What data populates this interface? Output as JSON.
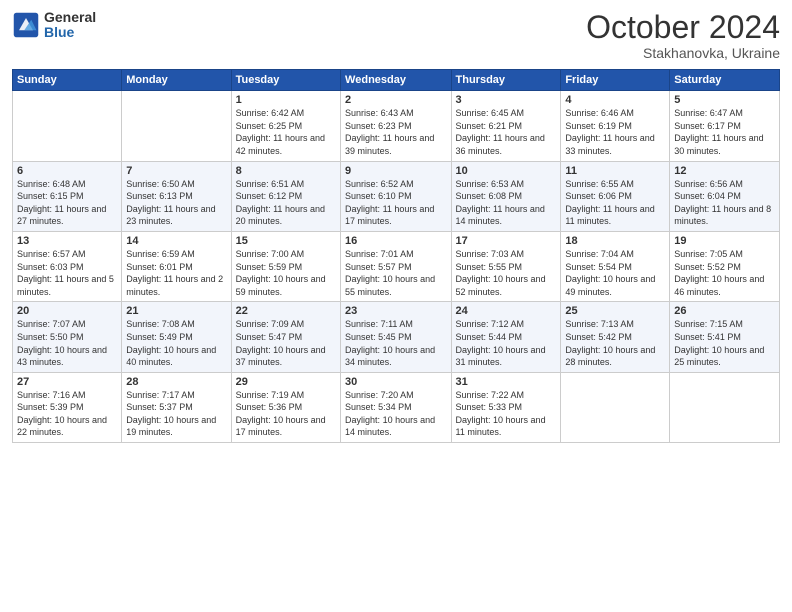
{
  "header": {
    "logo_general": "General",
    "logo_blue": "Blue",
    "month": "October 2024",
    "location": "Stakhanovka, Ukraine"
  },
  "weekdays": [
    "Sunday",
    "Monday",
    "Tuesday",
    "Wednesday",
    "Thursday",
    "Friday",
    "Saturday"
  ],
  "weeks": [
    [
      {
        "day": "",
        "sunrise": "",
        "sunset": "",
        "daylight": ""
      },
      {
        "day": "",
        "sunrise": "",
        "sunset": "",
        "daylight": ""
      },
      {
        "day": "1",
        "sunrise": "Sunrise: 6:42 AM",
        "sunset": "Sunset: 6:25 PM",
        "daylight": "Daylight: 11 hours and 42 minutes."
      },
      {
        "day": "2",
        "sunrise": "Sunrise: 6:43 AM",
        "sunset": "Sunset: 6:23 PM",
        "daylight": "Daylight: 11 hours and 39 minutes."
      },
      {
        "day": "3",
        "sunrise": "Sunrise: 6:45 AM",
        "sunset": "Sunset: 6:21 PM",
        "daylight": "Daylight: 11 hours and 36 minutes."
      },
      {
        "day": "4",
        "sunrise": "Sunrise: 6:46 AM",
        "sunset": "Sunset: 6:19 PM",
        "daylight": "Daylight: 11 hours and 33 minutes."
      },
      {
        "day": "5",
        "sunrise": "Sunrise: 6:47 AM",
        "sunset": "Sunset: 6:17 PM",
        "daylight": "Daylight: 11 hours and 30 minutes."
      }
    ],
    [
      {
        "day": "6",
        "sunrise": "Sunrise: 6:48 AM",
        "sunset": "Sunset: 6:15 PM",
        "daylight": "Daylight: 11 hours and 27 minutes."
      },
      {
        "day": "7",
        "sunrise": "Sunrise: 6:50 AM",
        "sunset": "Sunset: 6:13 PM",
        "daylight": "Daylight: 11 hours and 23 minutes."
      },
      {
        "day": "8",
        "sunrise": "Sunrise: 6:51 AM",
        "sunset": "Sunset: 6:12 PM",
        "daylight": "Daylight: 11 hours and 20 minutes."
      },
      {
        "day": "9",
        "sunrise": "Sunrise: 6:52 AM",
        "sunset": "Sunset: 6:10 PM",
        "daylight": "Daylight: 11 hours and 17 minutes."
      },
      {
        "day": "10",
        "sunrise": "Sunrise: 6:53 AM",
        "sunset": "Sunset: 6:08 PM",
        "daylight": "Daylight: 11 hours and 14 minutes."
      },
      {
        "day": "11",
        "sunrise": "Sunrise: 6:55 AM",
        "sunset": "Sunset: 6:06 PM",
        "daylight": "Daylight: 11 hours and 11 minutes."
      },
      {
        "day": "12",
        "sunrise": "Sunrise: 6:56 AM",
        "sunset": "Sunset: 6:04 PM",
        "daylight": "Daylight: 11 hours and 8 minutes."
      }
    ],
    [
      {
        "day": "13",
        "sunrise": "Sunrise: 6:57 AM",
        "sunset": "Sunset: 6:03 PM",
        "daylight": "Daylight: 11 hours and 5 minutes."
      },
      {
        "day": "14",
        "sunrise": "Sunrise: 6:59 AM",
        "sunset": "Sunset: 6:01 PM",
        "daylight": "Daylight: 11 hours and 2 minutes."
      },
      {
        "day": "15",
        "sunrise": "Sunrise: 7:00 AM",
        "sunset": "Sunset: 5:59 PM",
        "daylight": "Daylight: 10 hours and 59 minutes."
      },
      {
        "day": "16",
        "sunrise": "Sunrise: 7:01 AM",
        "sunset": "Sunset: 5:57 PM",
        "daylight": "Daylight: 10 hours and 55 minutes."
      },
      {
        "day": "17",
        "sunrise": "Sunrise: 7:03 AM",
        "sunset": "Sunset: 5:55 PM",
        "daylight": "Daylight: 10 hours and 52 minutes."
      },
      {
        "day": "18",
        "sunrise": "Sunrise: 7:04 AM",
        "sunset": "Sunset: 5:54 PM",
        "daylight": "Daylight: 10 hours and 49 minutes."
      },
      {
        "day": "19",
        "sunrise": "Sunrise: 7:05 AM",
        "sunset": "Sunset: 5:52 PM",
        "daylight": "Daylight: 10 hours and 46 minutes."
      }
    ],
    [
      {
        "day": "20",
        "sunrise": "Sunrise: 7:07 AM",
        "sunset": "Sunset: 5:50 PM",
        "daylight": "Daylight: 10 hours and 43 minutes."
      },
      {
        "day": "21",
        "sunrise": "Sunrise: 7:08 AM",
        "sunset": "Sunset: 5:49 PM",
        "daylight": "Daylight: 10 hours and 40 minutes."
      },
      {
        "day": "22",
        "sunrise": "Sunrise: 7:09 AM",
        "sunset": "Sunset: 5:47 PM",
        "daylight": "Daylight: 10 hours and 37 minutes."
      },
      {
        "day": "23",
        "sunrise": "Sunrise: 7:11 AM",
        "sunset": "Sunset: 5:45 PM",
        "daylight": "Daylight: 10 hours and 34 minutes."
      },
      {
        "day": "24",
        "sunrise": "Sunrise: 7:12 AM",
        "sunset": "Sunset: 5:44 PM",
        "daylight": "Daylight: 10 hours and 31 minutes."
      },
      {
        "day": "25",
        "sunrise": "Sunrise: 7:13 AM",
        "sunset": "Sunset: 5:42 PM",
        "daylight": "Daylight: 10 hours and 28 minutes."
      },
      {
        "day": "26",
        "sunrise": "Sunrise: 7:15 AM",
        "sunset": "Sunset: 5:41 PM",
        "daylight": "Daylight: 10 hours and 25 minutes."
      }
    ],
    [
      {
        "day": "27",
        "sunrise": "Sunrise: 7:16 AM",
        "sunset": "Sunset: 5:39 PM",
        "daylight": "Daylight: 10 hours and 22 minutes."
      },
      {
        "day": "28",
        "sunrise": "Sunrise: 7:17 AM",
        "sunset": "Sunset: 5:37 PM",
        "daylight": "Daylight: 10 hours and 19 minutes."
      },
      {
        "day": "29",
        "sunrise": "Sunrise: 7:19 AM",
        "sunset": "Sunset: 5:36 PM",
        "daylight": "Daylight: 10 hours and 17 minutes."
      },
      {
        "day": "30",
        "sunrise": "Sunrise: 7:20 AM",
        "sunset": "Sunset: 5:34 PM",
        "daylight": "Daylight: 10 hours and 14 minutes."
      },
      {
        "day": "31",
        "sunrise": "Sunrise: 7:22 AM",
        "sunset": "Sunset: 5:33 PM",
        "daylight": "Daylight: 10 hours and 11 minutes."
      },
      {
        "day": "",
        "sunrise": "",
        "sunset": "",
        "daylight": ""
      },
      {
        "day": "",
        "sunrise": "",
        "sunset": "",
        "daylight": ""
      }
    ]
  ]
}
